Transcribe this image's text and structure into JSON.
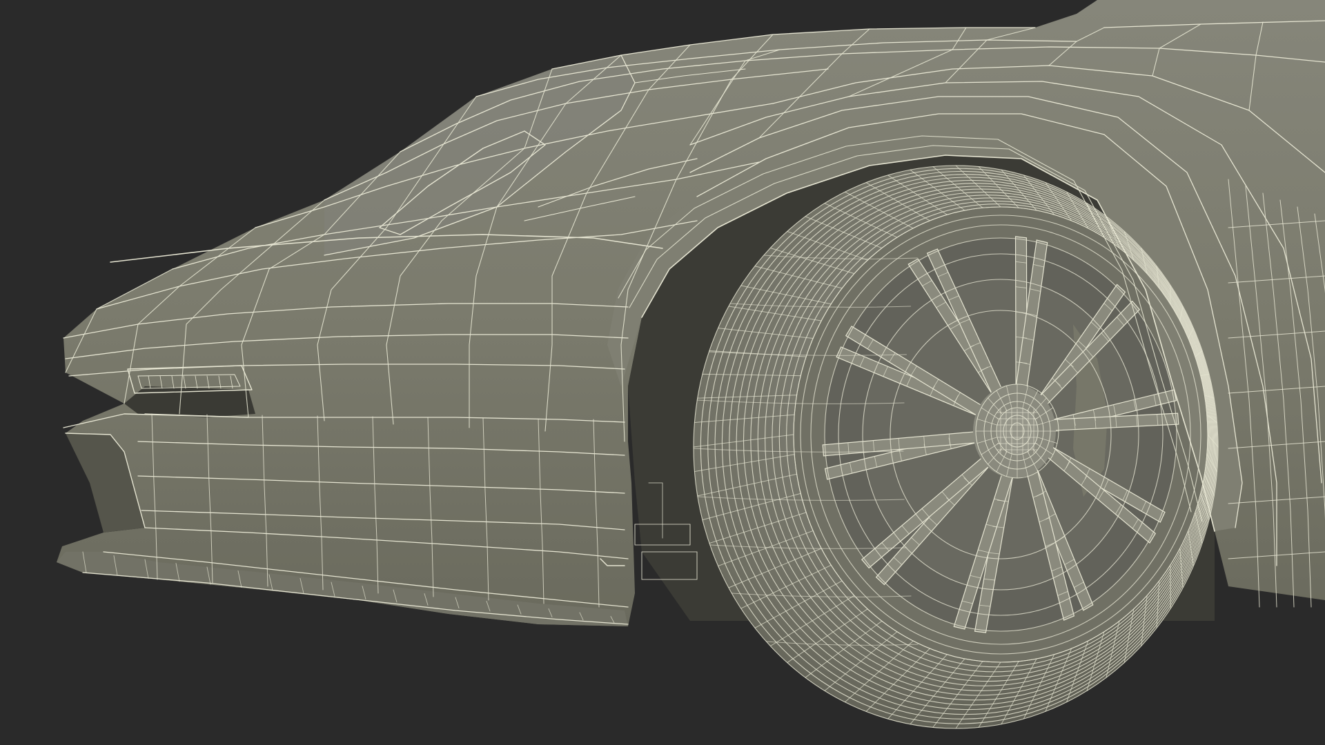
{
  "scene": {
    "subject": "car-front-wireframe",
    "background_color": "#2a2a2a",
    "surface_color": "#7b7b6c",
    "surface_shadow_color": "#5f5f53",
    "wire_color": "#e6e5d2"
  }
}
